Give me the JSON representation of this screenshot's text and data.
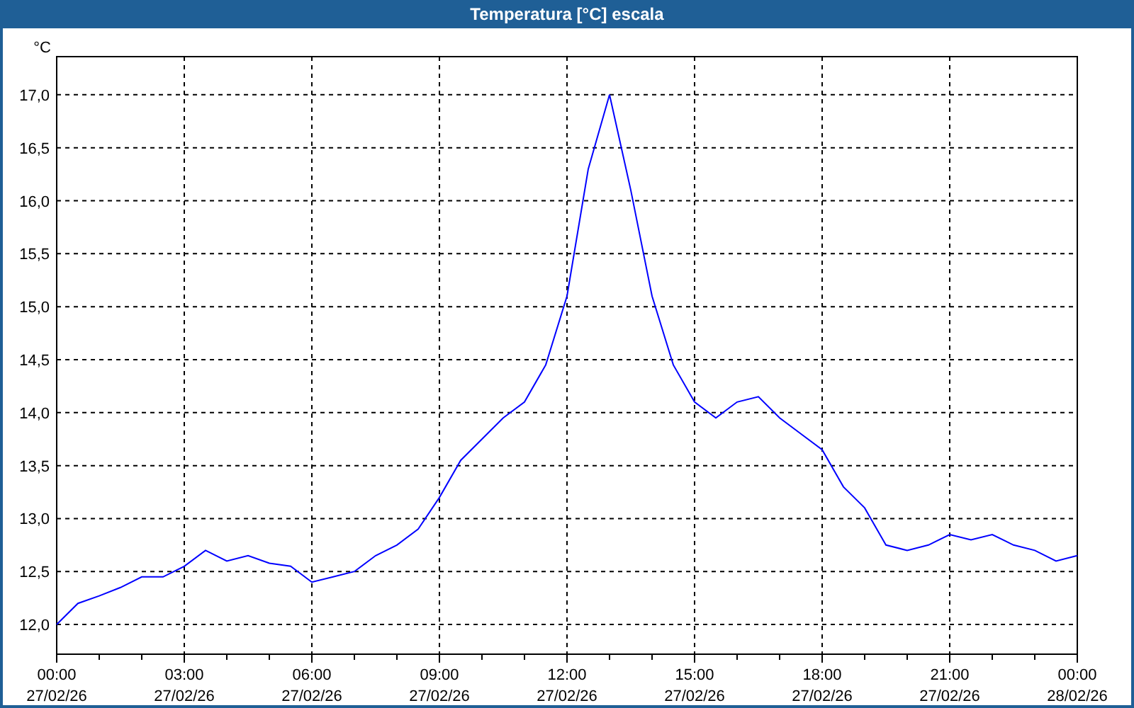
{
  "chart_data": {
    "type": "line",
    "title": "Temperatura [°C] escala",
    "ylabel": "°C",
    "categories": [
      "00:00 27/02/26",
      null,
      null,
      null,
      null,
      null,
      "03:00 27/02/26",
      null,
      null,
      null,
      null,
      null,
      "06:00 27/02/26",
      null,
      null,
      null,
      null,
      null,
      "09:00 27/02/26",
      null,
      null,
      null,
      null,
      null,
      "12:00 27/02/26",
      null,
      null,
      null,
      null,
      null,
      "15:00 27/02/26",
      null,
      null,
      null,
      null,
      null,
      "18:00 27/02/26",
      null,
      null,
      null,
      null,
      null,
      "21:00 27/02/26",
      null,
      null,
      null,
      null,
      null,
      "00:00 28/02/26"
    ],
    "series": [
      {
        "color": "#0000ff",
        "values": [
          12.0,
          12.2,
          12.27,
          12.35,
          12.45,
          12.45,
          12.55,
          12.7,
          12.6,
          12.65,
          12.58,
          12.55,
          12.4,
          12.45,
          12.5,
          12.65,
          12.75,
          12.9,
          13.2,
          13.55,
          13.75,
          13.95,
          14.1,
          14.45,
          15.1,
          16.3,
          17.0,
          16.1,
          15.1,
          14.45,
          14.1,
          13.95,
          14.1,
          14.15,
          13.95,
          13.8,
          13.65,
          13.3,
          13.1,
          12.75,
          12.7,
          12.75,
          12.85,
          12.8,
          12.85,
          12.75,
          12.7,
          12.6,
          12.65
        ]
      }
    ],
    "ylim": [
      11.72,
      17.36
    ],
    "grid": true,
    "yticks": [
      {
        "value": 12,
        "label": "12,0"
      },
      {
        "value": 12.5,
        "label": "12,5"
      },
      {
        "value": 13,
        "label": "13,0"
      },
      {
        "value": 13.5,
        "label": "13,5"
      },
      {
        "value": 14,
        "label": "14,0"
      },
      {
        "value": 14.5,
        "label": "14,5"
      },
      {
        "value": 15,
        "label": "15,0"
      },
      {
        "value": 15.5,
        "label": "15,5"
      },
      {
        "value": 16,
        "label": "16,0"
      },
      {
        "value": 16.5,
        "label": "16,5"
      },
      {
        "value": 17,
        "label": "17,0"
      }
    ]
  }
}
